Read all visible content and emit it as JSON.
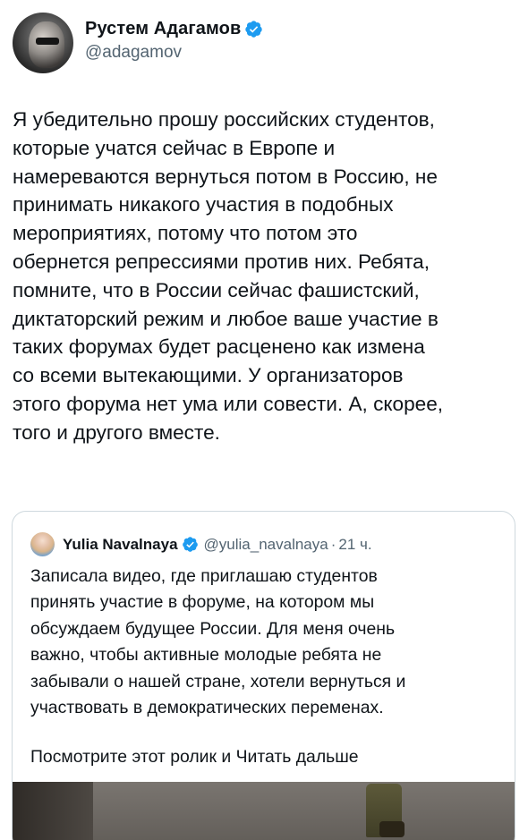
{
  "tweet": {
    "author_name": "Рустем Адагамов",
    "handle": "@adagamov",
    "verified_icon": "verified-badge-icon",
    "accent_color": "#1d9bf0",
    "text": "Я убедительно прошу российских студентов,\nкоторые учатся сейчас в Европе и\nнамереваются вернуться потом в Россию, не\nпринимать никакого участия в подобных\nмероприятиях, потому что потом это\nобернется репрессиями против них. Ребята,\nпомните, что в России сейчас фашистский,\nдиктаторский режим и любое ваше участие в\nтаких форумах будет расценено как измена\nсо всеми вытекающими. У организаторов\nэтого форума нет ума или совести. А, скорее,\nтого и другого вместе."
  },
  "quote": {
    "author_name": "Yulia Navalnaya",
    "handle": "@yulia_navalnaya",
    "separator": "·",
    "time": "21 ч.",
    "text": "Записала видео, где приглашаю студентов\nпринять участие в форуме, на котором мы\nобсуждаем будущее России. Для меня очень\nважно, чтобы активные молодые ребята не\nзабывали о нашей стране, хотели вернуться и\nучаствовать в демократических переменах.",
    "tail_text": "Посмотрите этот ролик и ",
    "read_more": "Читать дальше"
  }
}
